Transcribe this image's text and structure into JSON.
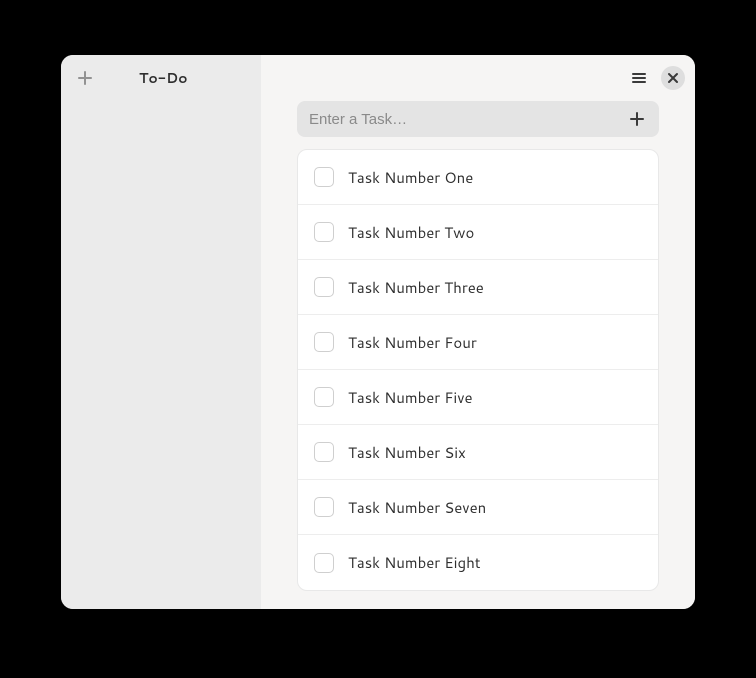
{
  "sidebar": {
    "title": "To-Do"
  },
  "input": {
    "placeholder": "Enter a Task…"
  },
  "tasks": [
    {
      "label": "Task Number One"
    },
    {
      "label": "Task Number Two"
    },
    {
      "label": "Task Number Three"
    },
    {
      "label": "Task Number Four"
    },
    {
      "label": "Task Number Five"
    },
    {
      "label": "Task Number Six"
    },
    {
      "label": "Task Number Seven"
    },
    {
      "label": "Task Number Eight"
    }
  ]
}
